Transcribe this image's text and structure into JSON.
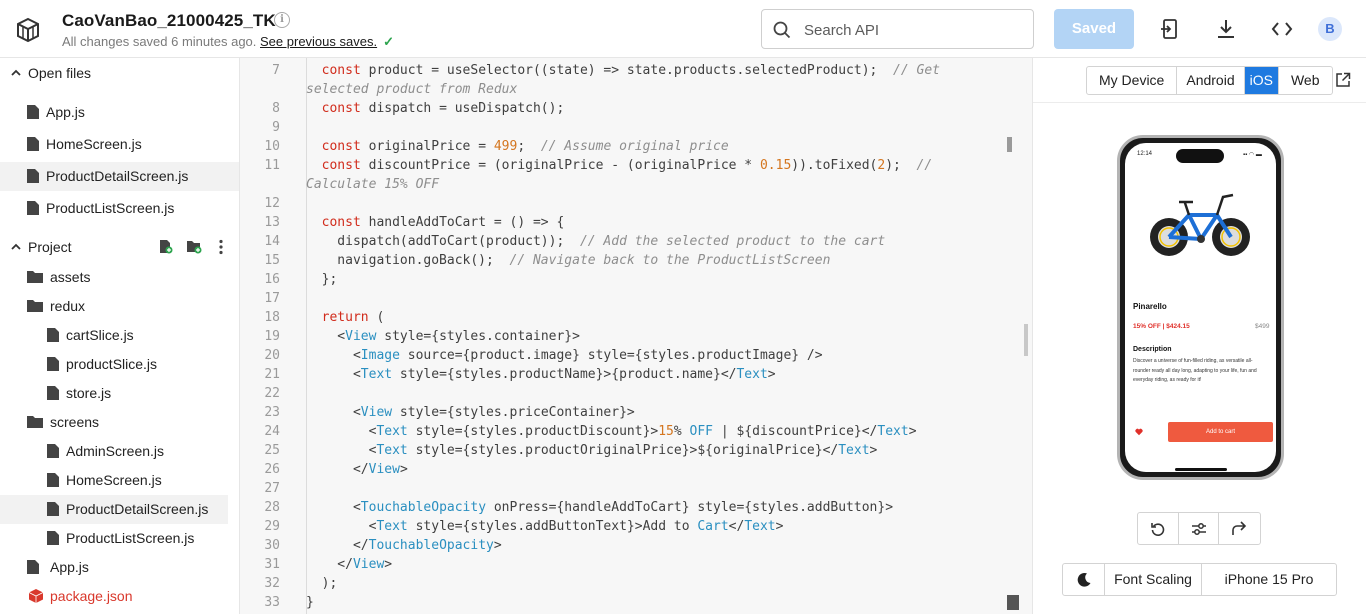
{
  "header": {
    "project_title": "CaoVanBao_21000425_TK",
    "save_status_prefix": "All changes saved 6 minutes ago. ",
    "save_status_link": "See previous saves.",
    "search_placeholder": "Search API",
    "saved_button": "Saved",
    "avatar_initial": "B",
    "icons": [
      "snack-logo-icon",
      "info-icon",
      "search-icon",
      "device-connect-icon",
      "download-icon",
      "embed-code-icon"
    ]
  },
  "sidebar": {
    "open_files_label": "Open files",
    "open_files": [
      "App.js",
      "HomeScreen.js",
      "ProductDetailScreen.js",
      "ProductListScreen.js"
    ],
    "open_files_selected": "ProductDetailScreen.js",
    "project_label": "Project",
    "project_tree": {
      "assets": "assets",
      "redux": "redux",
      "redux_files": [
        "cartSlice.js",
        "productSlice.js",
        "store.js"
      ],
      "screens": "screens",
      "screens_files": [
        "AdminScreen.js",
        "HomeScreen.js",
        "ProductDetailScreen.js",
        "ProductListScreen.js"
      ],
      "root_files": [
        "App.js"
      ],
      "package": "package.json"
    },
    "package_color": "#d9382c"
  },
  "editor": {
    "lines": [
      {
        "n": "7",
        "c": "  const product = useSelector((state) => state.products.selectedProduct);  // Get"
      },
      {
        "n": "",
        "c": "selected product from Redux"
      },
      {
        "n": "8",
        "c": "  const dispatch = useDispatch();"
      },
      {
        "n": "9",
        "c": ""
      },
      {
        "n": "10",
        "c": "  const originalPrice = 499;  // Assume original price"
      },
      {
        "n": "11",
        "c": "  const discountPrice = (originalPrice - (originalPrice * 0.15)).toFixed(2);  //"
      },
      {
        "n": "",
        "c": "Calculate 15% OFF"
      },
      {
        "n": "12",
        "c": ""
      },
      {
        "n": "13",
        "c": "  const handleAddToCart = () => {"
      },
      {
        "n": "14",
        "c": "    dispatch(addToCart(product));  // Add the selected product to the cart"
      },
      {
        "n": "15",
        "c": "    navigation.goBack();  // Navigate back to the ProductListScreen"
      },
      {
        "n": "16",
        "c": "  };"
      },
      {
        "n": "17",
        "c": ""
      },
      {
        "n": "18",
        "c": "  return ("
      },
      {
        "n": "19",
        "c": "    <View style={styles.container}>"
      },
      {
        "n": "20",
        "c": "      <Image source={product.image} style={styles.productImage} />"
      },
      {
        "n": "21",
        "c": "      <Text style={styles.productName}>{product.name}</Text>"
      },
      {
        "n": "22",
        "c": ""
      },
      {
        "n": "23",
        "c": "      <View style={styles.priceContainer}>"
      },
      {
        "n": "24",
        "c": "        <Text style={styles.productDiscount}>15% OFF | ${discountPrice}</Text>"
      },
      {
        "n": "25",
        "c": "        <Text style={styles.productOriginalPrice}>${originalPrice}</Text>"
      },
      {
        "n": "26",
        "c": "      </View>"
      },
      {
        "n": "27",
        "c": ""
      },
      {
        "n": "28",
        "c": "      <TouchableOpacity onPress={handleAddToCart} style={styles.addButton}>"
      },
      {
        "n": "29",
        "c": "        <Text style={styles.addButtonText}>Add to Cart</Text>"
      },
      {
        "n": "30",
        "c": "      </TouchableOpacity>"
      },
      {
        "n": "31",
        "c": "    </View>"
      },
      {
        "n": "32",
        "c": "  );"
      },
      {
        "n": "33",
        "c": "}"
      }
    ]
  },
  "preview": {
    "platform_tabs": [
      "My Device",
      "Android",
      "iOS",
      "Web"
    ],
    "active_tab": "iOS",
    "phone": {
      "time": "12:14",
      "status": "▪▪ ◠ ▬",
      "product_name": "Pinarello",
      "discount_text": "15% OFF | $424.15",
      "original_price": "$499",
      "description_title": "Description",
      "description_text": "Discover a universe of fun-filled riding, as versatile all-rounder ready all day long, adapting to your life, fun and everyday riding, as ready for it!",
      "add_to_cart": "Add to cart",
      "accent_color": "#ef5a3f"
    },
    "controls_icons": [
      "reload-icon",
      "settings-sliders-icon",
      "share-arrow-icon"
    ],
    "font_scaling": "Font Scaling",
    "device_name": "iPhone 15 Pro",
    "active_color": "#1f7ae0"
  }
}
